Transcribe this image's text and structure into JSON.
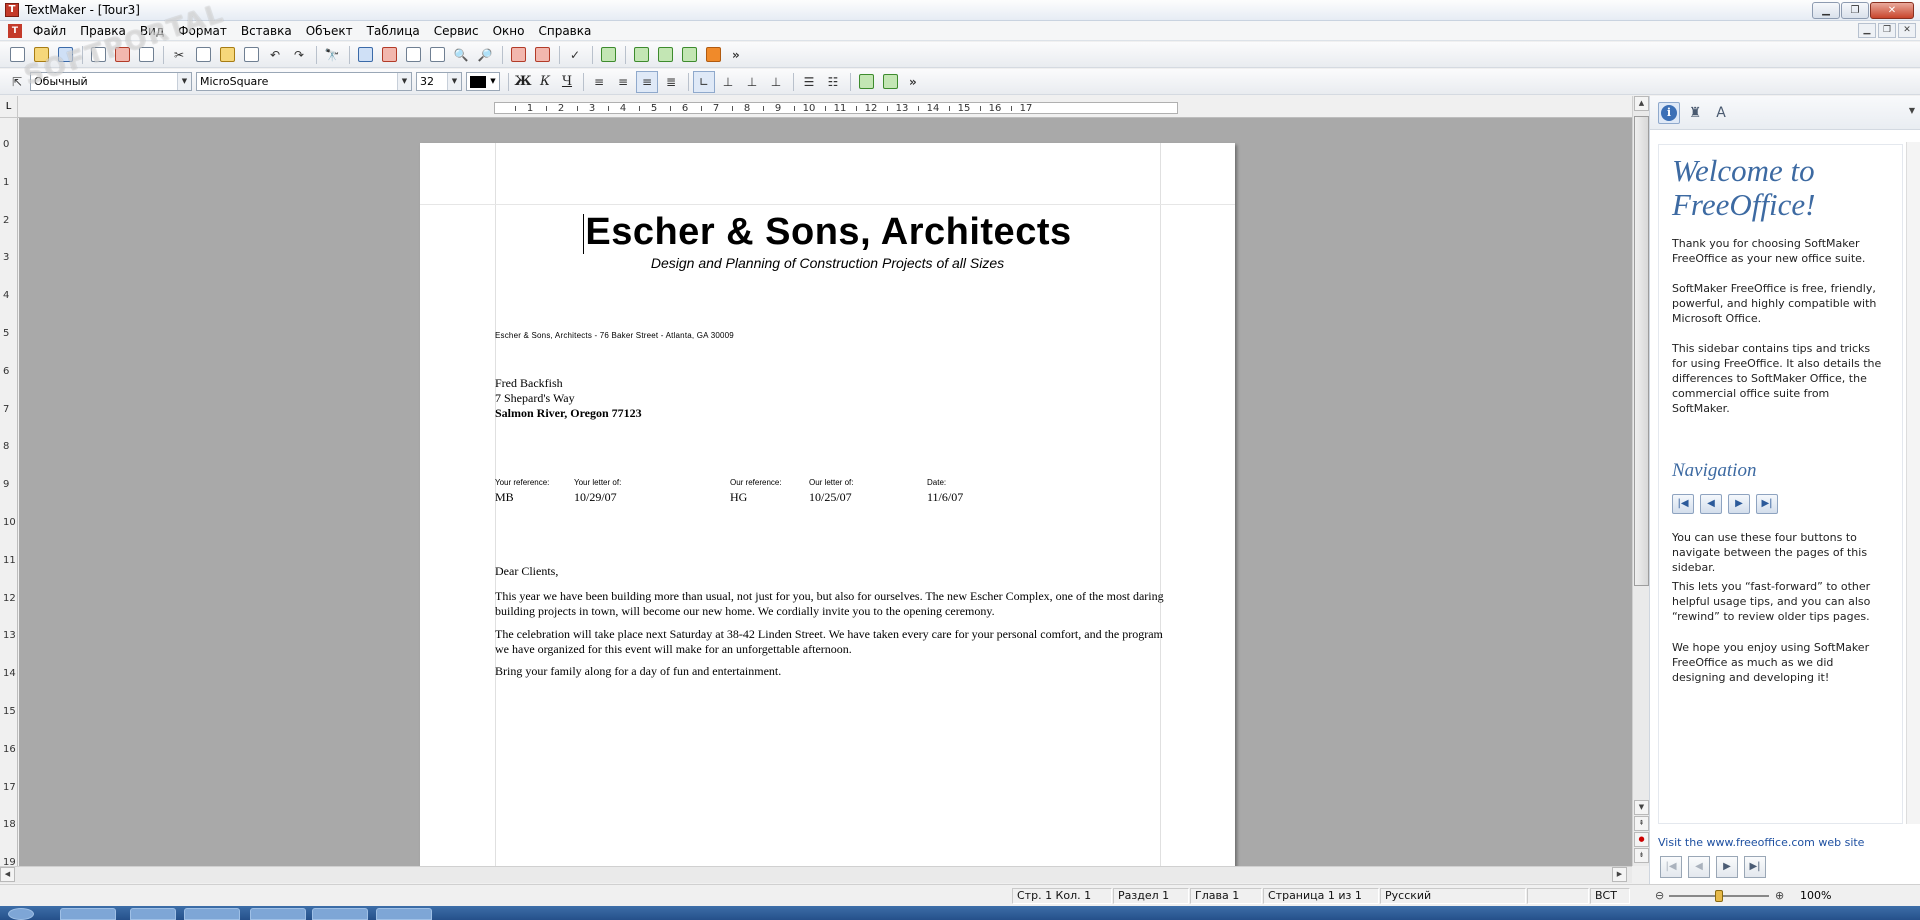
{
  "window": {
    "title": "TextMaker - [Tour3]",
    "app_icon": "T"
  },
  "menu": [
    "Файл",
    "Правка",
    "Вид",
    "Формат",
    "Вставка",
    "Объект",
    "Таблица",
    "Сервис",
    "Окно",
    "Справка"
  ],
  "toolbar2": {
    "style_value": "Обычный",
    "font_value": "MicroSquare",
    "size_value": "32",
    "text_color": "#000000",
    "format_buttons": [
      "Ж",
      "К",
      "Ч"
    ]
  },
  "ruler": {
    "h_ticks": [
      "1",
      "2",
      "3",
      "4",
      "5",
      "6",
      "7",
      "8",
      "9",
      "10",
      "11",
      "12",
      "13",
      "14",
      "15",
      "16",
      "17"
    ],
    "v_ticks": [
      "0",
      "1",
      "2",
      "3",
      "4",
      "5",
      "6",
      "7",
      "8",
      "9",
      "10",
      "11",
      "12",
      "13",
      "14",
      "15",
      "16",
      "17",
      "18",
      "19"
    ],
    "corner": "L"
  },
  "document": {
    "title": "Escher & Sons, Architects",
    "subtitle": "Design and Planning of Construction Projects of all Sizes",
    "sender_line": "Escher & Sons, Architects - 76 Baker Street - Atlanta, GA 30009",
    "address": [
      "Fred Backfish",
      "7 Shepard's Way",
      "Salmon River, Oregon 77123"
    ],
    "refs": [
      {
        "label": "Your reference:",
        "value": "MB"
      },
      {
        "label": "Your letter of:",
        "value": "10/29/07"
      },
      {
        "label": "Our reference:",
        "value": "HG"
      },
      {
        "label": "Our letter of:",
        "value": "10/25/07"
      },
      {
        "label": "Date:",
        "value": "11/6/07"
      }
    ],
    "salutation": "Dear Clients,",
    "paragraphs": [
      "This year we have been building more than usual, not just for you, but also for ourselves. The new Escher Complex, one of the most daring building projects in town, will become our new home. We cordially invite you to the opening ceremony.",
      "The celebration will take place next Saturday at 38-42 Linden Street. We have taken every care for your personal comfort, and the program we have organized for this event will make for an unforgettable afternoon.",
      "Bring your family along for a day of fun and entertainment."
    ]
  },
  "sidebar": {
    "heading": "Welcome to FreeOffice!",
    "p1": "Thank you for choosing SoftMaker FreeOffice as your new office suite.",
    "p2": "SoftMaker FreeOffice is free, friendly, powerful, and highly compatible with Microsoft Office.",
    "p3": "This sidebar contains tips and tricks for using FreeOffice. It also details the differences to SoftMaker Office, the commercial office suite from SoftMaker.",
    "nav_heading": "Navigation",
    "p4": "You can use these four buttons to navigate between the pages of this sidebar.",
    "p5": "This lets you “fast-forward” to other helpful usage tips, and you can also “rewind” to review older tips pages.",
    "p6": "We hope you enjoy using SoftMaker FreeOffice as much as we did designing and developing it!",
    "link_prefix": "Visit the ",
    "link_text": "www.freeoffice.com",
    "link_suffix": " web site"
  },
  "status": {
    "position": "Стр. 1 Кол. 1",
    "section": "Раздел 1",
    "chapter": "Глава 1",
    "page": "Страница 1 из 1",
    "language": "Русский",
    "mode": "ВСТ",
    "zoom": "100%",
    "zoom_level": 0.5
  },
  "watermark": "SOFTPORTAL",
  "colors": {
    "accent": "#3d6aa2",
    "doc_bg": "#a9a9a9",
    "link": "#1d4fa0"
  }
}
